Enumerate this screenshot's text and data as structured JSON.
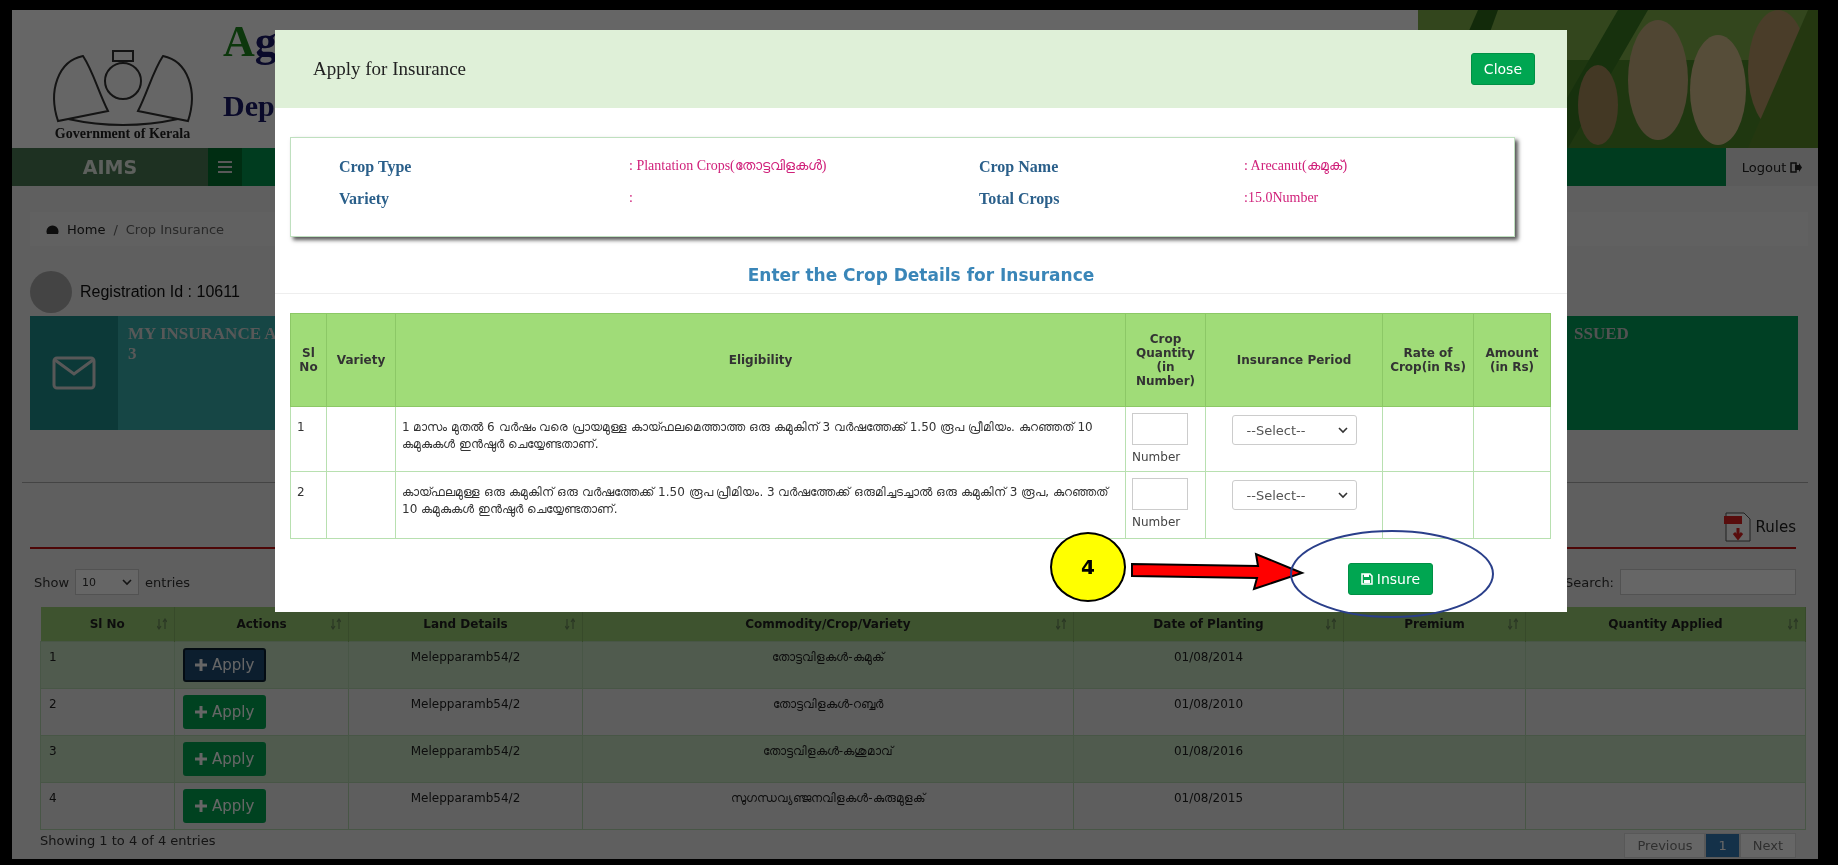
{
  "header": {
    "emblem_caption": "Government of Kerala",
    "title": "Ag",
    "subtitle": "Dep"
  },
  "nav": {
    "brand": "AIMS",
    "logout": "Logout"
  },
  "breadcrumb": [
    {
      "label": "Home"
    },
    {
      "label": "Crop Insurance"
    }
  ],
  "breadcrumb_separator": "/",
  "registration": "Registration Id : 10611",
  "cards": [
    {
      "title": "MY INSURANCE A",
      "count": "3"
    },
    {
      "title": "SSUED"
    }
  ],
  "rules_link": "Rules",
  "table_controls": {
    "show": "Show",
    "page_size": "10",
    "entries": "entries",
    "search_label": "Search:"
  },
  "table": {
    "columns": [
      "Sl No",
      "Actions",
      "Land Details",
      "Commodity/Crop/Variety",
      "Date of Planting",
      "Premium",
      "Quantity Applied"
    ],
    "rows": [
      {
        "sl_no": "1",
        "action": "Apply",
        "selected": true,
        "land": "Melepparamb54/2",
        "commodity": "തോട്ടവിളകൾ-കമുക്",
        "date": "01/08/2014"
      },
      {
        "sl_no": "2",
        "action": "Apply",
        "selected": false,
        "land": "Melepparamb54/2",
        "commodity": "തോട്ടവിളകൾ-റബ്ബർ",
        "date": "01/08/2010"
      },
      {
        "sl_no": "3",
        "action": "Apply",
        "selected": false,
        "land": "Melepparamb54/2",
        "commodity": "തോട്ടവിളകൾ-കശുമാവ്",
        "date": "01/08/2016"
      },
      {
        "sl_no": "4",
        "action": "Apply",
        "selected": false,
        "land": "Melepparamb54/2",
        "commodity": "സുഗന്ധവ്യഞ്ജനവിളകൾ-കുരുമുളക്",
        "date": "01/08/2015"
      }
    ]
  },
  "footer": {
    "info": "Showing 1 to 4 of 4 entries",
    "pagination": [
      {
        "label": "Previous",
        "selected": false
      },
      {
        "label": "1",
        "selected": true
      },
      {
        "label": "Next",
        "selected": false
      }
    ]
  },
  "modal": {
    "title": "Apply for Insurance",
    "close": "Close",
    "info": [
      {
        "label": "Crop Type",
        "value": ": Plantation Crops(തോട്ടവിളകൾ)"
      },
      {
        "label": "Crop Name",
        "value": ": Arecanut(കമുക്)"
      },
      {
        "label": "Variety",
        "value": ":"
      },
      {
        "label": "Total Crops",
        "value": ":15.0Number"
      }
    ],
    "section_title": "Enter the Crop Details for Insurance",
    "columns": [
      "Sl No",
      "Variety",
      "Eligibility",
      "Crop Quantity (in Number)",
      "Insurance Period",
      "Rate of Crop(in Rs)",
      "Amount (in Rs)"
    ],
    "rows": [
      {
        "sl_no": "1",
        "eligibility": "1 മാസം മുതൽ 6 വർഷം വരെ പ്രായമുള്ള കായ്ഫലമെത്താത്ത ഒരു കമുകിന് 3 വർഷത്തേക്ക് 1.50 രൂപ പ്രീമിയം. കുറഞ്ഞത് 10 കമുകുകൾ ഇൻഷുർ ചെയ്യേണ്ടതാണ്.",
        "unit": "Number",
        "period": "--Select--"
      },
      {
        "sl_no": "2",
        "eligibility": "കായ്ഫലമുള്ള ഒരു കമുകിന് ഒരു വർഷത്തേക്ക് 1.50 രൂപ പ്രീമിയം. 3 വർഷത്തേക്ക് ഒരുമിച്ചടച്ചാൽ ഒരു കമുകിന് 3 രൂപ, കുറഞ്ഞത് 10 കമുകുകൾ ഇൻഷുർ ചെയ്യേണ്ടതാണ്.",
        "unit": "Number",
        "period": "--Select--"
      }
    ],
    "insure": "Insure",
    "step": "4"
  }
}
